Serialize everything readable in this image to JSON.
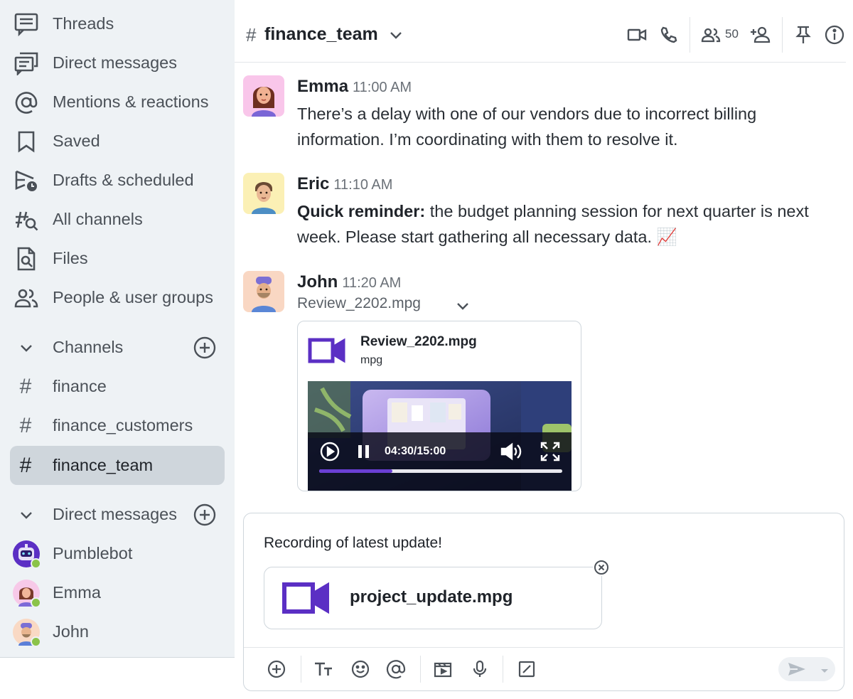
{
  "sidebar": {
    "nav": [
      {
        "label": "Threads",
        "icon": "threads-icon"
      },
      {
        "label": "Direct messages",
        "icon": "direct-messages-icon"
      },
      {
        "label": "Mentions & reactions",
        "icon": "at-icon"
      },
      {
        "label": "Saved",
        "icon": "bookmark-icon"
      },
      {
        "label": "Drafts & scheduled",
        "icon": "send-clock-icon"
      },
      {
        "label": "All channels",
        "icon": "channel-search-icon"
      },
      {
        "label": "Files",
        "icon": "file-search-icon"
      },
      {
        "label": "People & user groups",
        "icon": "people-icon"
      }
    ],
    "channels_header": "Channels",
    "channels": [
      "finance",
      "finance_customers",
      "finance_team"
    ],
    "active_channel": "finance_team",
    "dm_header": "Direct messages",
    "dms": [
      "Pumblebot",
      "Emma",
      "John"
    ]
  },
  "header": {
    "hash": "#",
    "channel": "finance_team",
    "member_count": "50"
  },
  "messages": [
    {
      "author": "Emma",
      "time": "11:00 AM",
      "text": "There’s a delay with one of our vendors due to incorrect billing information. I’m coordinating with them to resolve it."
    },
    {
      "author": "Eric",
      "time": "11:10 AM",
      "bold": "Quick reminder:",
      "text": " the budget planning session for next quarter is next week. Please start gathering all necessary data. 📈"
    },
    {
      "author": "John",
      "time": "11:20 AM",
      "file_link": "Review_2202.mpg",
      "video": {
        "title": "Review_2202.mpg",
        "ext": "mpg",
        "time": "04:30/15:00",
        "progress": 0.3
      }
    }
  ],
  "composer": {
    "text": "Recording of latest update!",
    "attachment": "project_update.mpg"
  },
  "colors": {
    "accent": "#5b2fc4",
    "sidebar_bg": "#eef2f5",
    "active_bg": "#cfd6dc",
    "online": "#8bc34a"
  }
}
